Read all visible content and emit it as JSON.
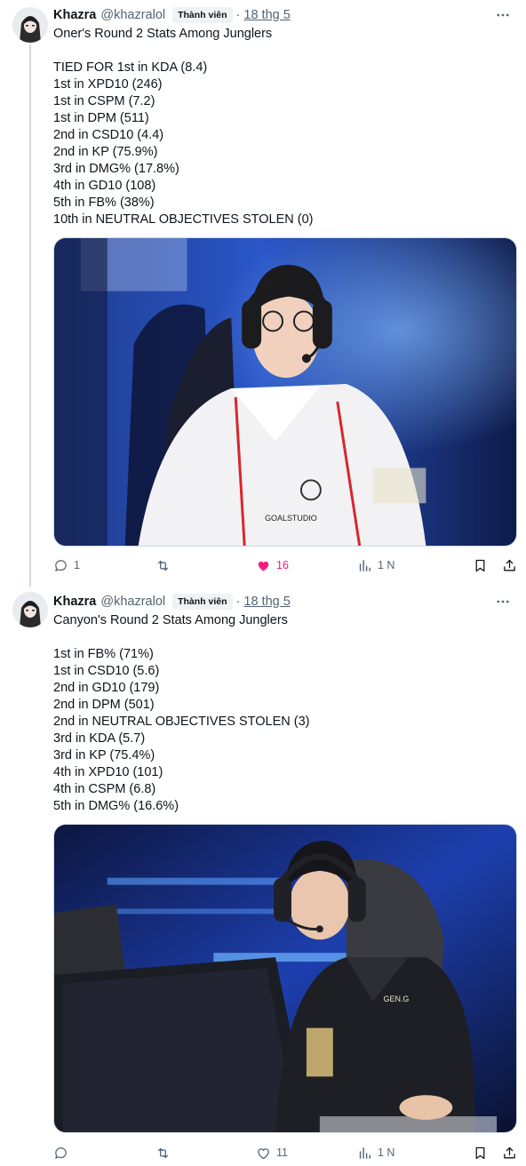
{
  "tweets": [
    {
      "author_name": "Khazra",
      "author_handle": "@khazralol",
      "badge": "Thành viên",
      "separator": "·",
      "date": "18 thg 5",
      "body_lines": [
        "Oner's Round 2 Stats Among Junglers",
        "",
        "TIED FOR 1st in KDA (8.4)",
        "1st in XPD10 (246)",
        "1st in CSPM (7.2)",
        "1st in DPM (511)",
        "2nd in CSD10 (4.4)",
        "2nd in KP (75.9%)",
        "3rd in DMG% (17.8%)",
        "4th in GD10 (108)",
        "5th in FB% (38%)",
        "10th in NEUTRAL OBJECTIVES STOLEN (0)"
      ],
      "replies": "1",
      "retweets": "",
      "likes": "16",
      "liked": true,
      "views": "1 N",
      "jersey_text": "GOALSTUDIO"
    },
    {
      "author_name": "Khazra",
      "author_handle": "@khazralol",
      "badge": "Thành viên",
      "separator": "·",
      "date": "18 thg 5",
      "body_lines": [
        "Canyon's Round 2 Stats Among Junglers",
        "",
        "1st in FB% (71%)",
        "1st in CSD10 (5.6)",
        "2nd in GD10 (179)",
        "2nd in DPM (501)",
        "2nd in NEUTRAL OBJECTIVES STOLEN (3)",
        "3rd in KDA (5.7)",
        "3rd in KP (75.4%)",
        "4th in XPD10 (101)",
        "4th in CSPM (6.8)",
        "5th in DMG% (16.6%)"
      ],
      "replies": "",
      "retweets": "",
      "likes": "11",
      "liked": false,
      "views": "1 N",
      "jersey_text": "GEN.G"
    }
  ],
  "colors": {
    "text": "#0f1419",
    "secondary": "#536471",
    "like": "#f91880",
    "border": "#cfd9de"
  }
}
